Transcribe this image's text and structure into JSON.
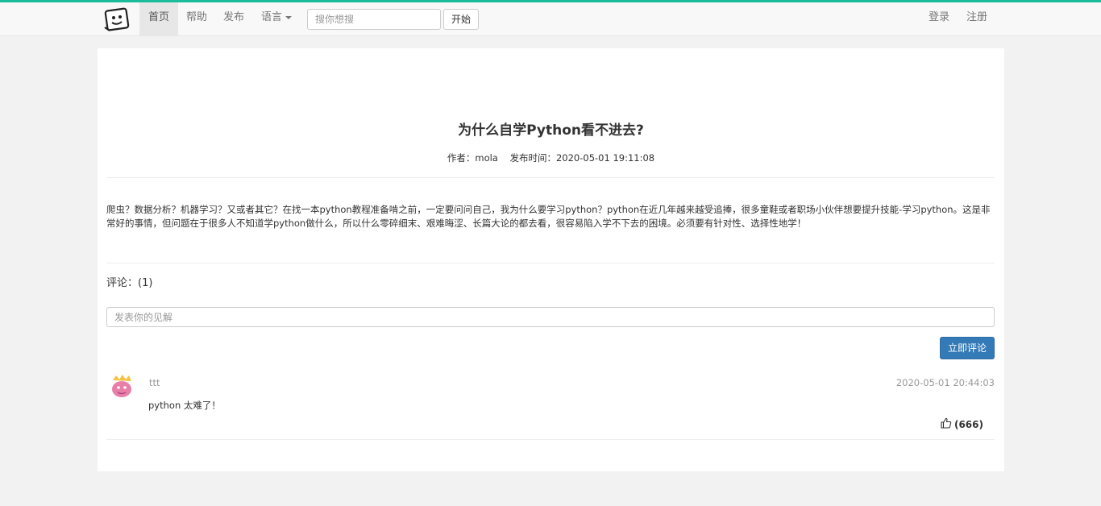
{
  "nav": {
    "items": [
      {
        "label": "首页",
        "active": true
      },
      {
        "label": "帮助",
        "active": false
      },
      {
        "label": "发布",
        "active": false
      },
      {
        "label": "语言",
        "active": false
      }
    ],
    "search_placeholder": "搜你想搜",
    "search_button": "开始",
    "login": "登录",
    "register": "注册"
  },
  "article": {
    "title": "为什么自学Python看不进去?",
    "meta": "作者：mola    发布时间：2020-05-01 19:11:08",
    "body": "爬虫？数据分析？机器学习？又或者其它？在找一本python教程准备啃之前，一定要问问自己，我为什么要学习python？python在近几年越来越受追捧，很多童鞋或者职场小伙伴想要提升技能-学习python。这是非常好的事情，但问题在于很多人不知道学python做什么，所以什么零碎细末、艰难晦涩、长篇大论的都去看，很容易陷入学不下去的困境。必须要有针对性、选择性地学！"
  },
  "comments": {
    "title": "评论：(1)",
    "input_placeholder": "发表你的见解",
    "submit_label": "立即评论",
    "list": [
      {
        "user": "ttt",
        "time": "2020-05-01 20:44:03",
        "text": "python 太难了！",
        "likes": "(666)"
      }
    ]
  },
  "colors": {
    "accent": "#1abc9c",
    "primary": "#337ab7"
  }
}
